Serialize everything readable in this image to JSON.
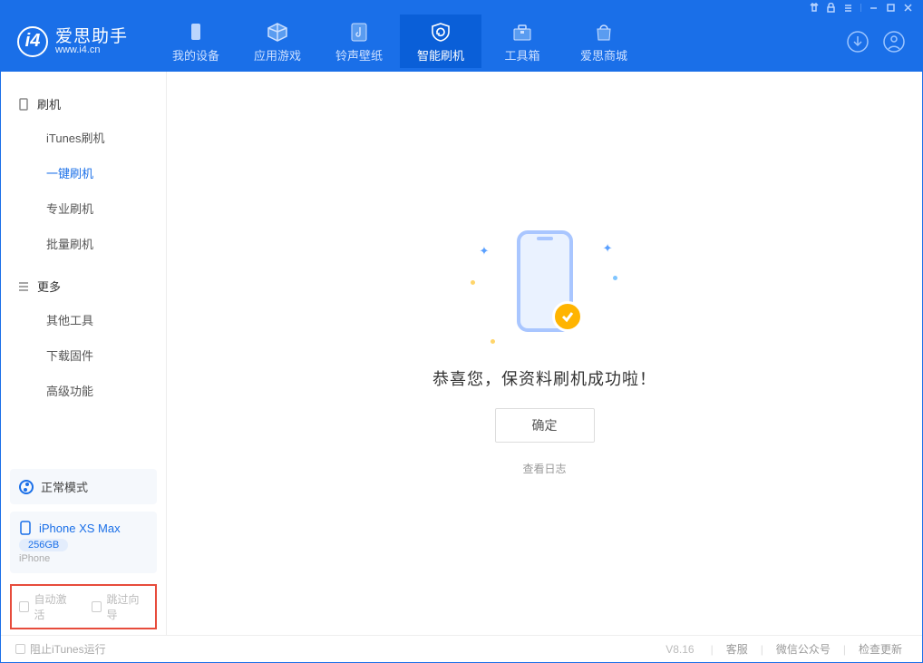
{
  "app": {
    "name": "爱思助手",
    "url": "www.i4.cn"
  },
  "tabs": {
    "device": "我的设备",
    "apps": "应用游戏",
    "ringtone": "铃声壁纸",
    "flash": "智能刷机",
    "toolbox": "工具箱",
    "store": "爱思商城"
  },
  "sidebar": {
    "group_flash": {
      "title": "刷机",
      "items": [
        "iTunes刷机",
        "一键刷机",
        "专业刷机",
        "批量刷机"
      ],
      "active_index": 1
    },
    "group_more": {
      "title": "更多",
      "items": [
        "其他工具",
        "下载固件",
        "高级功能"
      ]
    },
    "mode": "正常模式",
    "device": {
      "name": "iPhone XS Max",
      "capacity": "256GB",
      "type": "iPhone"
    },
    "options": {
      "auto_activate": "自动激活",
      "skip_wizard": "跳过向导"
    }
  },
  "main": {
    "success_text": "恭喜您，保资料刷机成功啦！",
    "ok_button": "确定",
    "view_log": "查看日志"
  },
  "footer": {
    "block_itunes": "阻止iTunes运行",
    "version": "V8.16",
    "links": [
      "客服",
      "微信公众号",
      "检查更新"
    ]
  }
}
